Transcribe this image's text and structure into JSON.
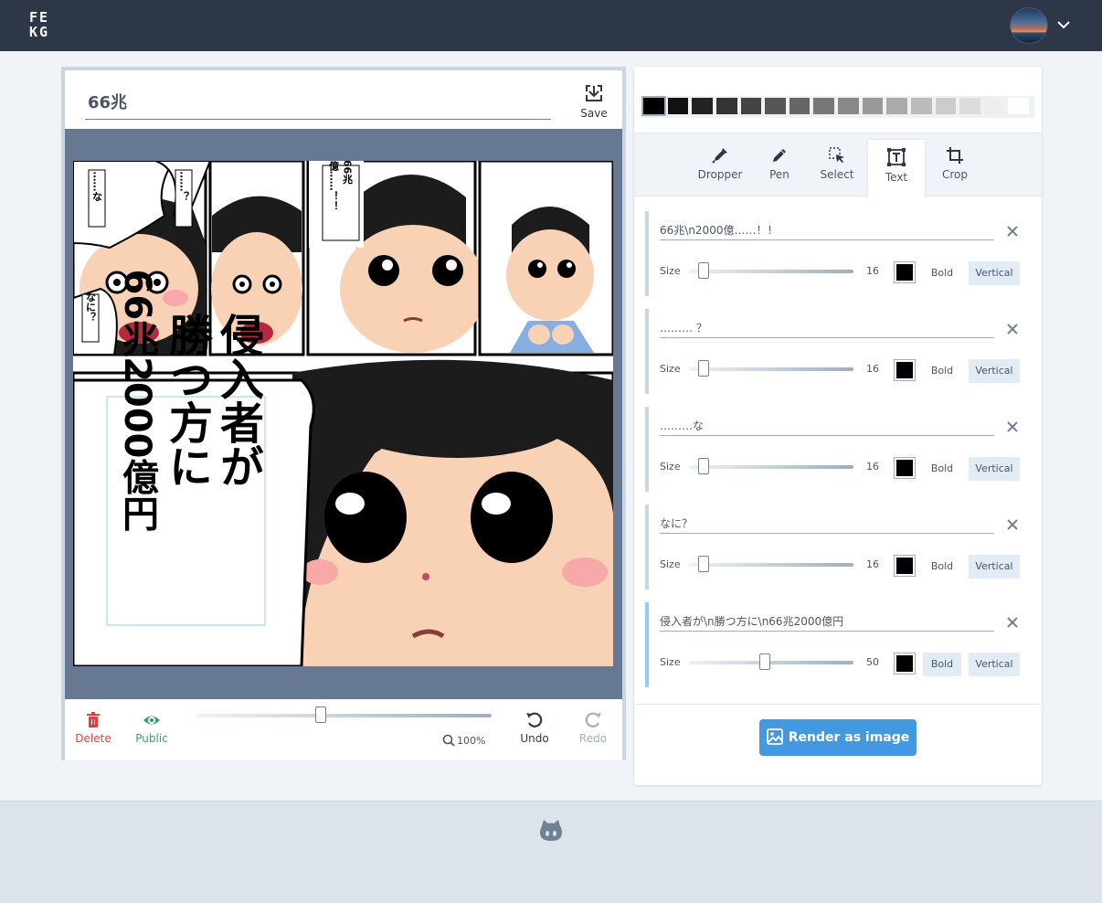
{
  "header": {
    "logo": [
      "FE",
      "KG"
    ],
    "avatar_icon": "user-avatar",
    "menu_icon": "chevron-down-icon"
  },
  "editor": {
    "title_value": "66兆",
    "save_label": "Save",
    "toolbar": {
      "delete_label": "Delete",
      "public_label": "Public",
      "zoom_label": "100%",
      "zoom_level": 0.42,
      "undo_label": "Undo",
      "redo_label": "Redo"
    },
    "comic_text": {
      "bubble1": "……な",
      "bubble2": "……？",
      "bubble3": "なに？",
      "bubble4": [
        "66兆",
        "2000億……！！"
      ],
      "big_text": [
        "侵入者が",
        "勝つ方に",
        "66兆2000億円"
      ]
    }
  },
  "palette": [
    "#000000",
    "#111111",
    "#222222",
    "#333333",
    "#444444",
    "#555555",
    "#666666",
    "#777777",
    "#888888",
    "#999999",
    "#aaaaaa",
    "#bbbbbb",
    "#cccccc",
    "#dddddd",
    "#eeeeee",
    "#ffffff"
  ],
  "tabs": [
    {
      "label": "Dropper",
      "icon": "dropper-icon"
    },
    {
      "label": "Pen",
      "icon": "pen-icon"
    },
    {
      "label": "Select",
      "icon": "select-icon"
    },
    {
      "label": "Text",
      "icon": "text-icon",
      "active": true
    },
    {
      "label": "Crop",
      "icon": "crop-icon"
    }
  ],
  "text_items": [
    {
      "value": "66兆\\n2000億……！！",
      "size_label": "Size",
      "size": "16",
      "size_fraction": 0.0,
      "bold_label": "Bold",
      "bold": false,
      "vertical_label": "Vertical",
      "vertical": true
    },
    {
      "value": "……… ？",
      "size_label": "Size",
      "size": "16",
      "size_fraction": 0.0,
      "bold_label": "Bold",
      "bold": false,
      "vertical_label": "Vertical",
      "vertical": true
    },
    {
      "value": "………な",
      "size_label": "Size",
      "size": "16",
      "size_fraction": 0.0,
      "bold_label": "Bold",
      "bold": false,
      "vertical_label": "Vertical",
      "vertical": true
    },
    {
      "value": "なに？",
      "size_label": "Size",
      "size": "16",
      "size_fraction": 0.0,
      "bold_label": "Bold",
      "bold": false,
      "vertical_label": "Vertical",
      "vertical": true
    },
    {
      "value": "侵入者が\\n勝つ方に\\n66兆2000億円",
      "size_label": "Size",
      "size": "50",
      "size_fraction": 0.4,
      "bold_label": "Bold",
      "bold": true,
      "vertical_label": "Vertical",
      "vertical": true,
      "active": true
    }
  ],
  "render_label": "Render as image",
  "footer": {
    "icon": "github-icon"
  }
}
